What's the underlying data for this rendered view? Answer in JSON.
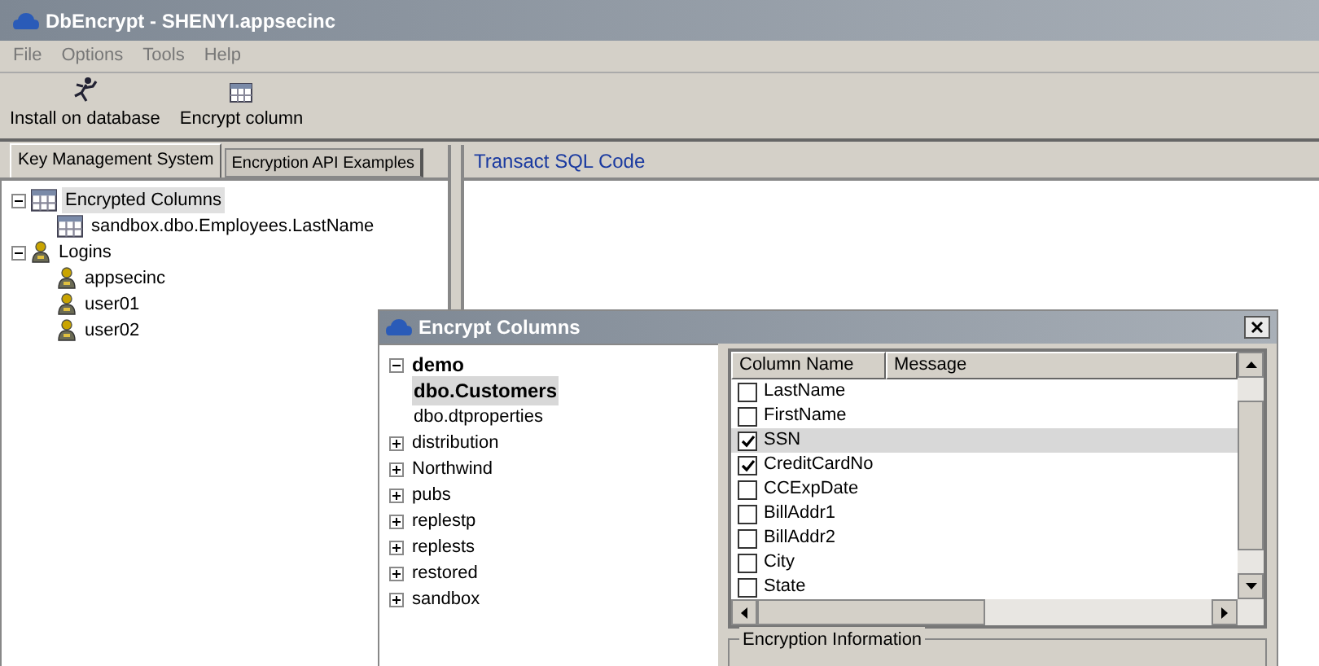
{
  "window": {
    "title": "DbEncrypt - SHENYI.appsecinc"
  },
  "menu": [
    "File",
    "Options",
    "Tools",
    "Help"
  ],
  "toolbar": [
    {
      "label": "Install on database",
      "kind": "install"
    },
    {
      "label": "Encrypt column",
      "kind": "grid"
    }
  ],
  "tabs": [
    {
      "label": "Key Management System",
      "selected": true
    },
    {
      "label": "Encryption API Examples",
      "selected": false
    }
  ],
  "tree": [
    {
      "label": "Encrypted Columns",
      "kind": "table",
      "expanded": true,
      "selected": true,
      "children": [
        {
          "label": "sandbox.dbo.Employees.LastName",
          "kind": "table",
          "selected": false
        }
      ]
    },
    {
      "label": "Logins",
      "kind": "user",
      "expanded": true,
      "selected": false,
      "children": [
        {
          "label": "appsecinc",
          "kind": "user",
          "selected": false
        },
        {
          "label": "user01",
          "kind": "user",
          "selected": false
        },
        {
          "label": "user02",
          "kind": "user",
          "selected": false
        }
      ]
    }
  ],
  "code_panel": {
    "title": "Transact SQL Code"
  },
  "dialog": {
    "title": "Encrypt Columns",
    "tree": [
      {
        "label": "demo",
        "bold": true,
        "expanded": true,
        "selected": false,
        "children": [
          {
            "label": "dbo.Customers",
            "bold": true,
            "selected": true
          },
          {
            "label": "dbo.dtproperties",
            "bold": false,
            "selected": false
          }
        ]
      },
      {
        "label": "distribution",
        "bold": false,
        "expanded": false,
        "selected": false
      },
      {
        "label": "Northwind",
        "bold": false,
        "expanded": false,
        "selected": false
      },
      {
        "label": "pubs",
        "bold": false,
        "expanded": false,
        "selected": false
      },
      {
        "label": "replestp",
        "bold": false,
        "expanded": false,
        "selected": false
      },
      {
        "label": "replests",
        "bold": false,
        "expanded": false,
        "selected": false
      },
      {
        "label": "restored",
        "bold": false,
        "expanded": false,
        "selected": false
      },
      {
        "label": "sandbox",
        "bold": false,
        "expanded": false,
        "selected": false
      }
    ],
    "columns": [
      "Column Name",
      "Message"
    ],
    "rows": [
      {
        "name": "LastName",
        "checked": false,
        "selected": false
      },
      {
        "name": "FirstName",
        "checked": false,
        "selected": false
      },
      {
        "name": "SSN",
        "checked": true,
        "selected": true
      },
      {
        "name": "CreditCardNo",
        "checked": true,
        "selected": false
      },
      {
        "name": "CCExpDate",
        "checked": false,
        "selected": false
      },
      {
        "name": "BillAddr1",
        "checked": false,
        "selected": false
      },
      {
        "name": "BillAddr2",
        "checked": false,
        "selected": false
      },
      {
        "name": "City",
        "checked": false,
        "selected": false
      },
      {
        "name": "State",
        "checked": false,
        "selected": false
      }
    ],
    "group_title": "Encryption Information"
  }
}
